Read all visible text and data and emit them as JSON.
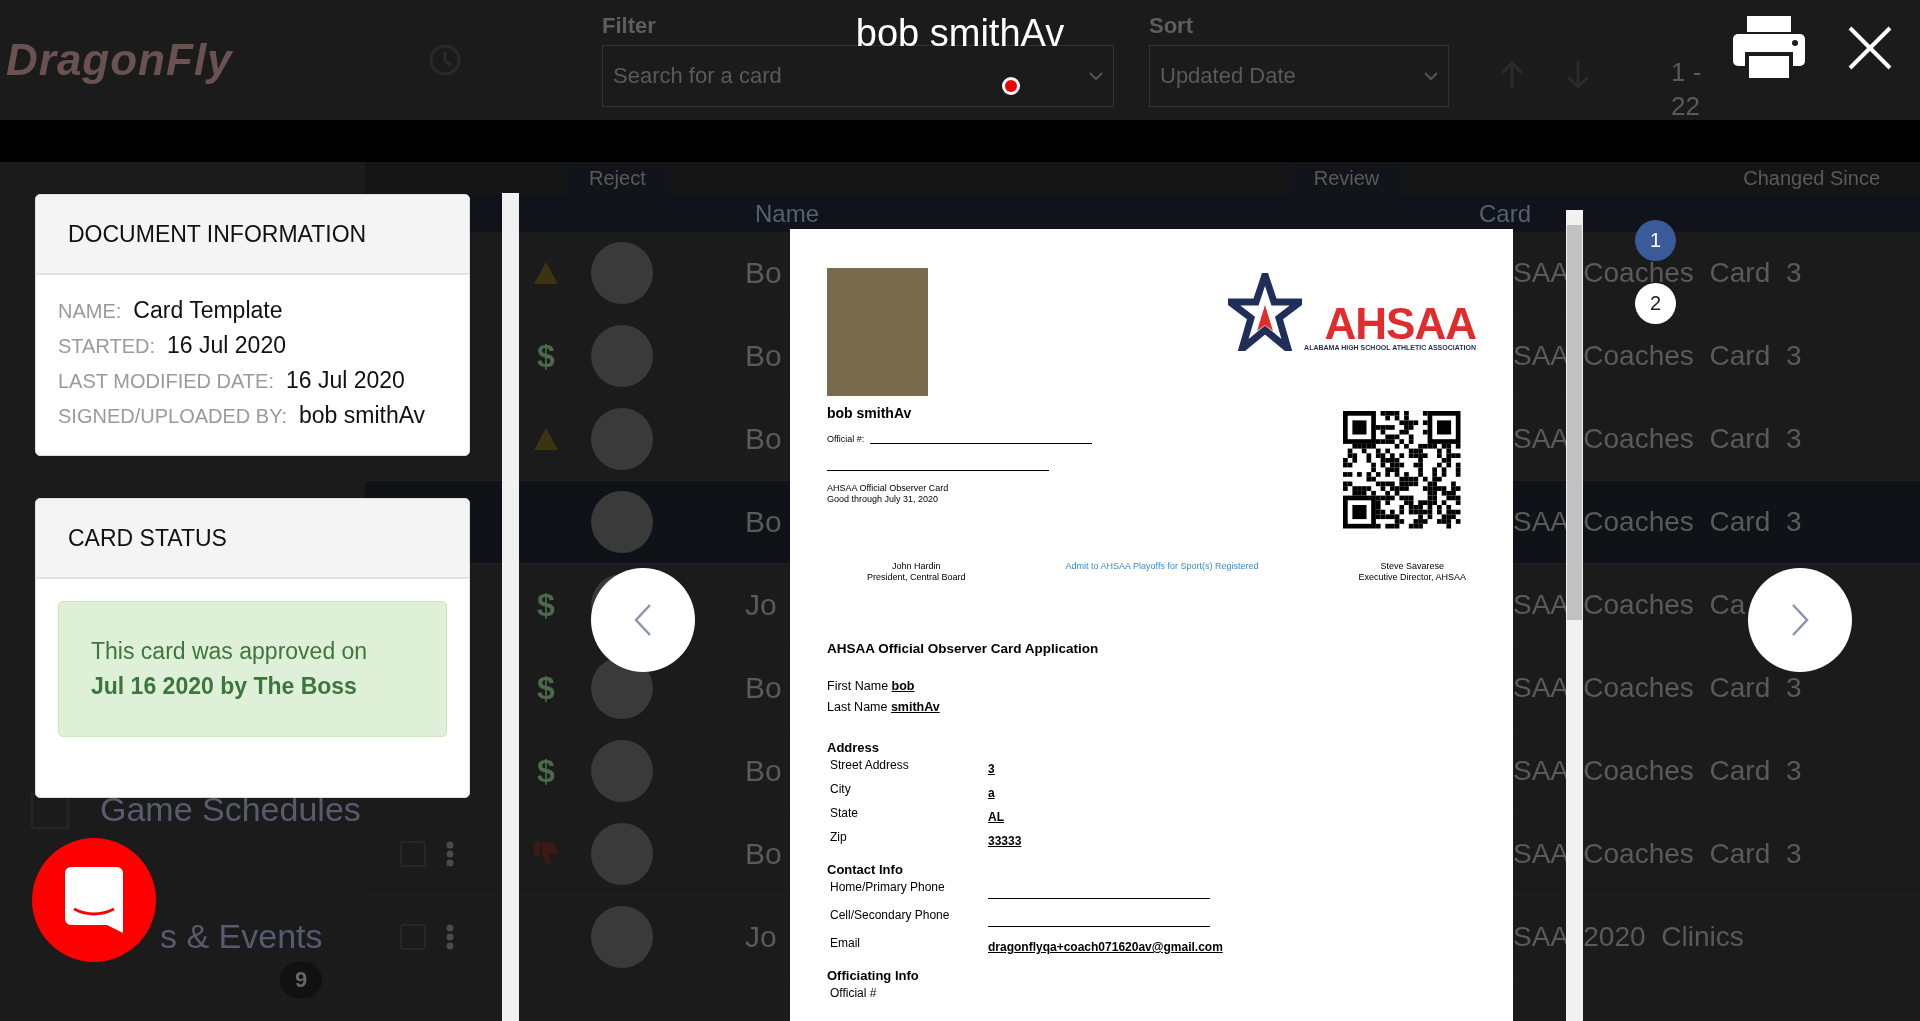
{
  "background_app": {
    "logo": "DragonFly",
    "filter": {
      "label": "Filter",
      "placeholder": "Search for a card"
    },
    "sort": {
      "label": "Sort",
      "value": "Updated Date"
    },
    "pagination": "1 - 22",
    "toolbar": [
      "Reject",
      "Review"
    ],
    "changed_since": {
      "placeholder": "Changed Since"
    },
    "sidebar": {
      "items": [
        "Game Schedules",
        "s & Events"
      ],
      "badge": "9"
    },
    "table": {
      "columns": [
        "Name",
        "Card"
      ],
      "rows": [
        {
          "name": "Bo",
          "card": "SAA Coaches Card 3",
          "kind": "warning",
          "selected": false
        },
        {
          "name": "Bo",
          "card": "SAA Coaches Card 3",
          "kind": "dollar",
          "icon_text": "$",
          "selected": false
        },
        {
          "name": "Bo",
          "card": "SAA Coaches Card 3",
          "kind": "warning",
          "selected": false
        },
        {
          "name": "Bo",
          "card": "SAA Coaches Card 3",
          "kind": "plain",
          "selected": true
        },
        {
          "name": "Jo",
          "card": "SAA Coaches Ca",
          "kind": "dollar",
          "icon_text": "$",
          "selected": false
        },
        {
          "name": "Bo",
          "card": "SAA Coaches Card 3",
          "kind": "dollar",
          "icon_text": "$",
          "selected": false
        },
        {
          "name": "Bo",
          "card": "SAA Coaches Card 3",
          "kind": "dollar",
          "icon_text": "$",
          "selected": false
        },
        {
          "name": "Bo",
          "card": "SAA Coaches Card 3",
          "kind": "thumbs-down",
          "selected": false
        },
        {
          "name": "Jo",
          "card": "SAA 2020 Clinics",
          "kind": "plain",
          "selected": false
        }
      ]
    }
  },
  "viewer": {
    "title": "bob smithAv",
    "document_information": {
      "heading": "DOCUMENT INFORMATION",
      "fields": [
        {
          "label": "NAME:",
          "value": "Card Template"
        },
        {
          "label": "STARTED:",
          "value": "16 Jul 2020"
        },
        {
          "label": "LAST MODIFIED DATE:",
          "value": "16 Jul 2020"
        },
        {
          "label": "SIGNED/UPLOADED BY:",
          "value": "bob smithAv"
        }
      ]
    },
    "card_status": {
      "heading": "CARD STATUS",
      "message": "This card was approved on **Jul 16 2020 by The Boss**"
    },
    "pages": [
      {
        "label": "1",
        "selected": true
      },
      {
        "label": "2",
        "selected": false
      }
    ],
    "document": {
      "holder_name": "bob smithAv",
      "official_label": "Official #:",
      "card_lines": [
        "AHSAA Official Observer Card",
        "Good through July 31, 2020"
      ],
      "logo": {
        "text": "AHSAA",
        "tagline": "ALABAMA HIGH SCHOOL ATHLETIC ASSOCIATION"
      },
      "signatures": [
        {
          "name": "John Hardin",
          "role": "President, Central Board"
        },
        {
          "name": "Steve Savarese",
          "role": "Executive Director, AHSAA"
        }
      ],
      "admit_note": "Admit to AHSAA Playoffs for Sport(s) Registered",
      "application_title": "AHSAA Official Observer Card Application",
      "name_fields": [
        {
          "label": "First Name",
          "value": "bob"
        },
        {
          "label": "Last Name",
          "value": "smithAv"
        }
      ],
      "sections": [
        {
          "heading": "Address",
          "fields": [
            {
              "label": "Street Address",
              "kind": "value",
              "value": "3"
            },
            {
              "label": "City",
              "kind": "value",
              "value": "a"
            },
            {
              "label": "State",
              "kind": "value",
              "value": "AL"
            },
            {
              "label": "Zip",
              "kind": "value",
              "value": "33333"
            }
          ]
        },
        {
          "heading": "Contact Info",
          "fields": [
            {
              "label": "Home/Primary Phone",
              "kind": "blank"
            },
            {
              "label": "Cell/Secondary Phone",
              "kind": "blank"
            },
            {
              "label": "Email",
              "kind": "value",
              "value": "dragonflyqa+coach071620av@gmail.com"
            }
          ]
        },
        {
          "heading": "Officiating Info",
          "fields": [
            {
              "label": "Official #",
              "kind": "label"
            }
          ]
        }
      ]
    }
  }
}
